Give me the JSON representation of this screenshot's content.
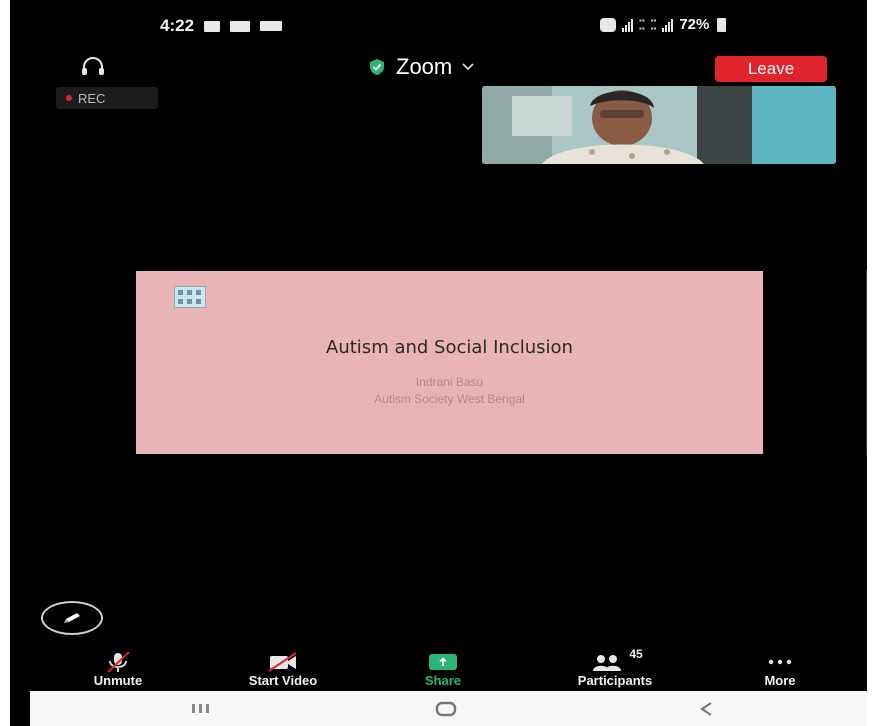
{
  "status_bar": {
    "time": "4:22",
    "battery": "72%"
  },
  "header": {
    "app_title": "Zoom",
    "leave_label": "Leave",
    "rec_label": "REC"
  },
  "shared_slide": {
    "title": "Autism and Social Inclusion",
    "presenter": "Indrani Basu",
    "organization": "Autism Society West Bengal"
  },
  "toolbar": {
    "unmute_label": "Unmute",
    "start_video_label": "Start Video",
    "share_label": "Share",
    "participants_label": "Participants",
    "participants_count": "45",
    "more_label": "More"
  },
  "colors": {
    "leave": "#e0242b",
    "share": "#2bb673",
    "slide_background": "#e8b4b6",
    "screen_background": "#000000"
  },
  "icons": [
    "headset-icon",
    "shield-check-icon",
    "chevron-down-icon",
    "pencil-icon",
    "microphone-muted-icon",
    "video-off-icon",
    "share-arrow-icon",
    "participants-icon",
    "more-dots-icon",
    "recent-apps-icon",
    "home-icon",
    "back-icon"
  ]
}
